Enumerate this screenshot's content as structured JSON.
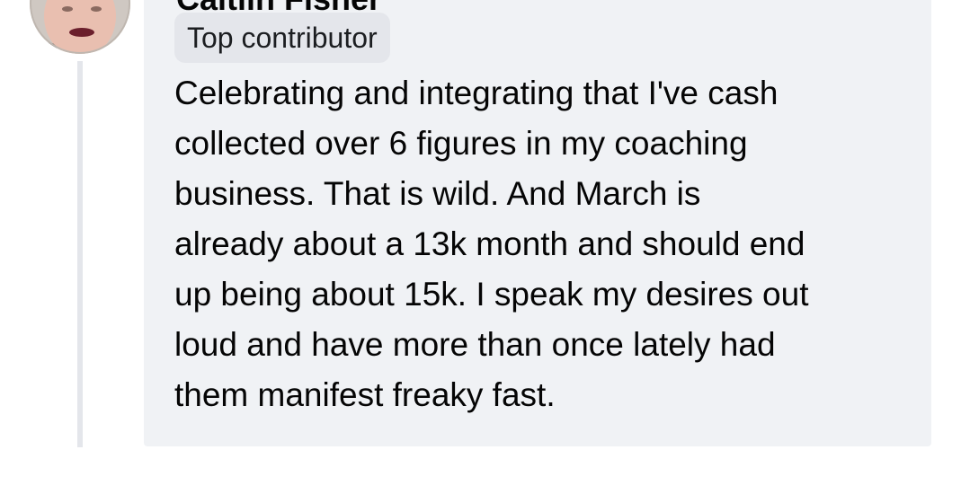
{
  "comment": {
    "author_name": "Caitlin Fisher",
    "badge_label": "Top contributor",
    "text": "Celebrating and integrating that I've cash\ncollected over 6 figures in my coaching\nbusiness. That is wild. And March is\nalready about a 13k month and should end\nup being about 15k. I speak my desires out\nloud and have more than once lately had\nthem manifest freaky fast."
  },
  "colors": {
    "bubble_background": "#f0f2f5",
    "badge_background": "#e4e6eb",
    "thread_line": "#e4e6eb",
    "text": "#050505"
  },
  "icons": {
    "avatar": "user-avatar-photo"
  }
}
